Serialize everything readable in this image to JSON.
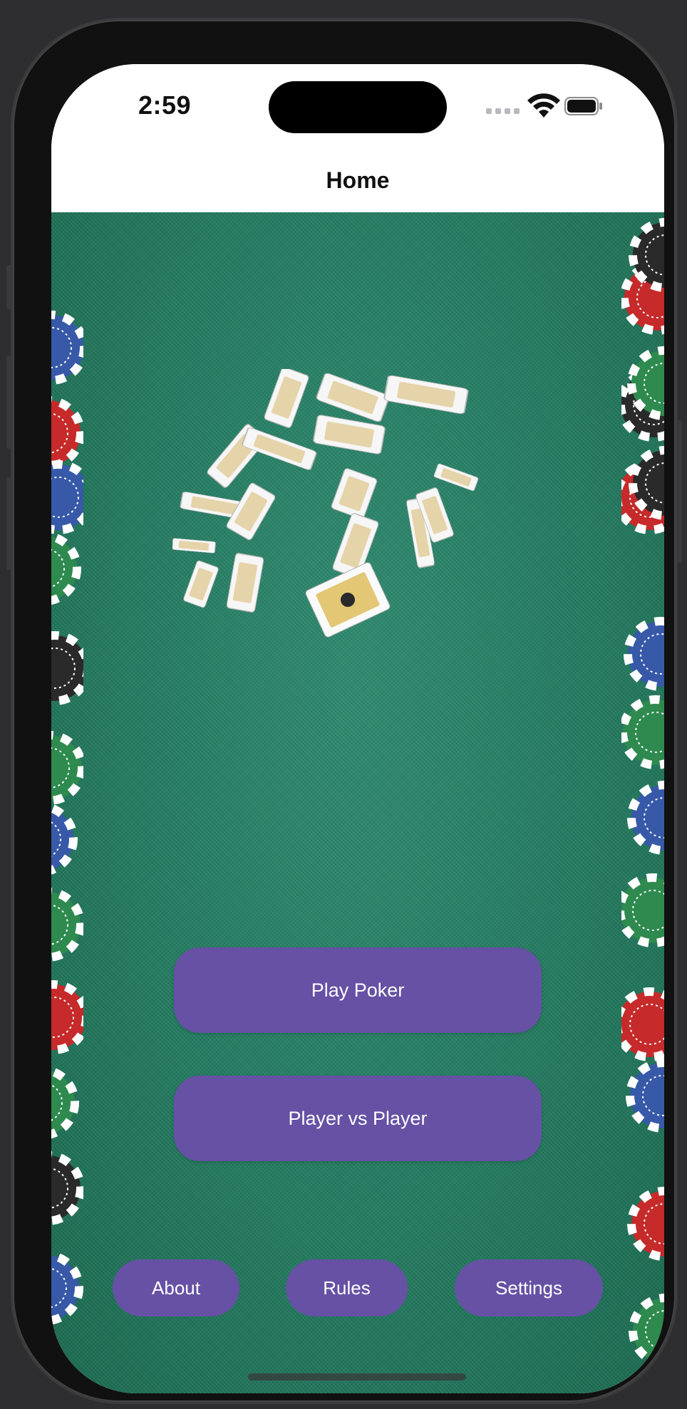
{
  "status_bar": {
    "time": "2:59"
  },
  "nav": {
    "title": "Home"
  },
  "buttons": {
    "play_poker": "Play Poker",
    "player_vs_player": "Player vs Player",
    "about": "About",
    "rules": "Rules",
    "settings": "Settings"
  },
  "colors": {
    "accent": "#6651a5",
    "felt": "#237a5f"
  },
  "icons": [
    "wifi-icon",
    "battery-icon",
    "cellular-signal-icon"
  ]
}
